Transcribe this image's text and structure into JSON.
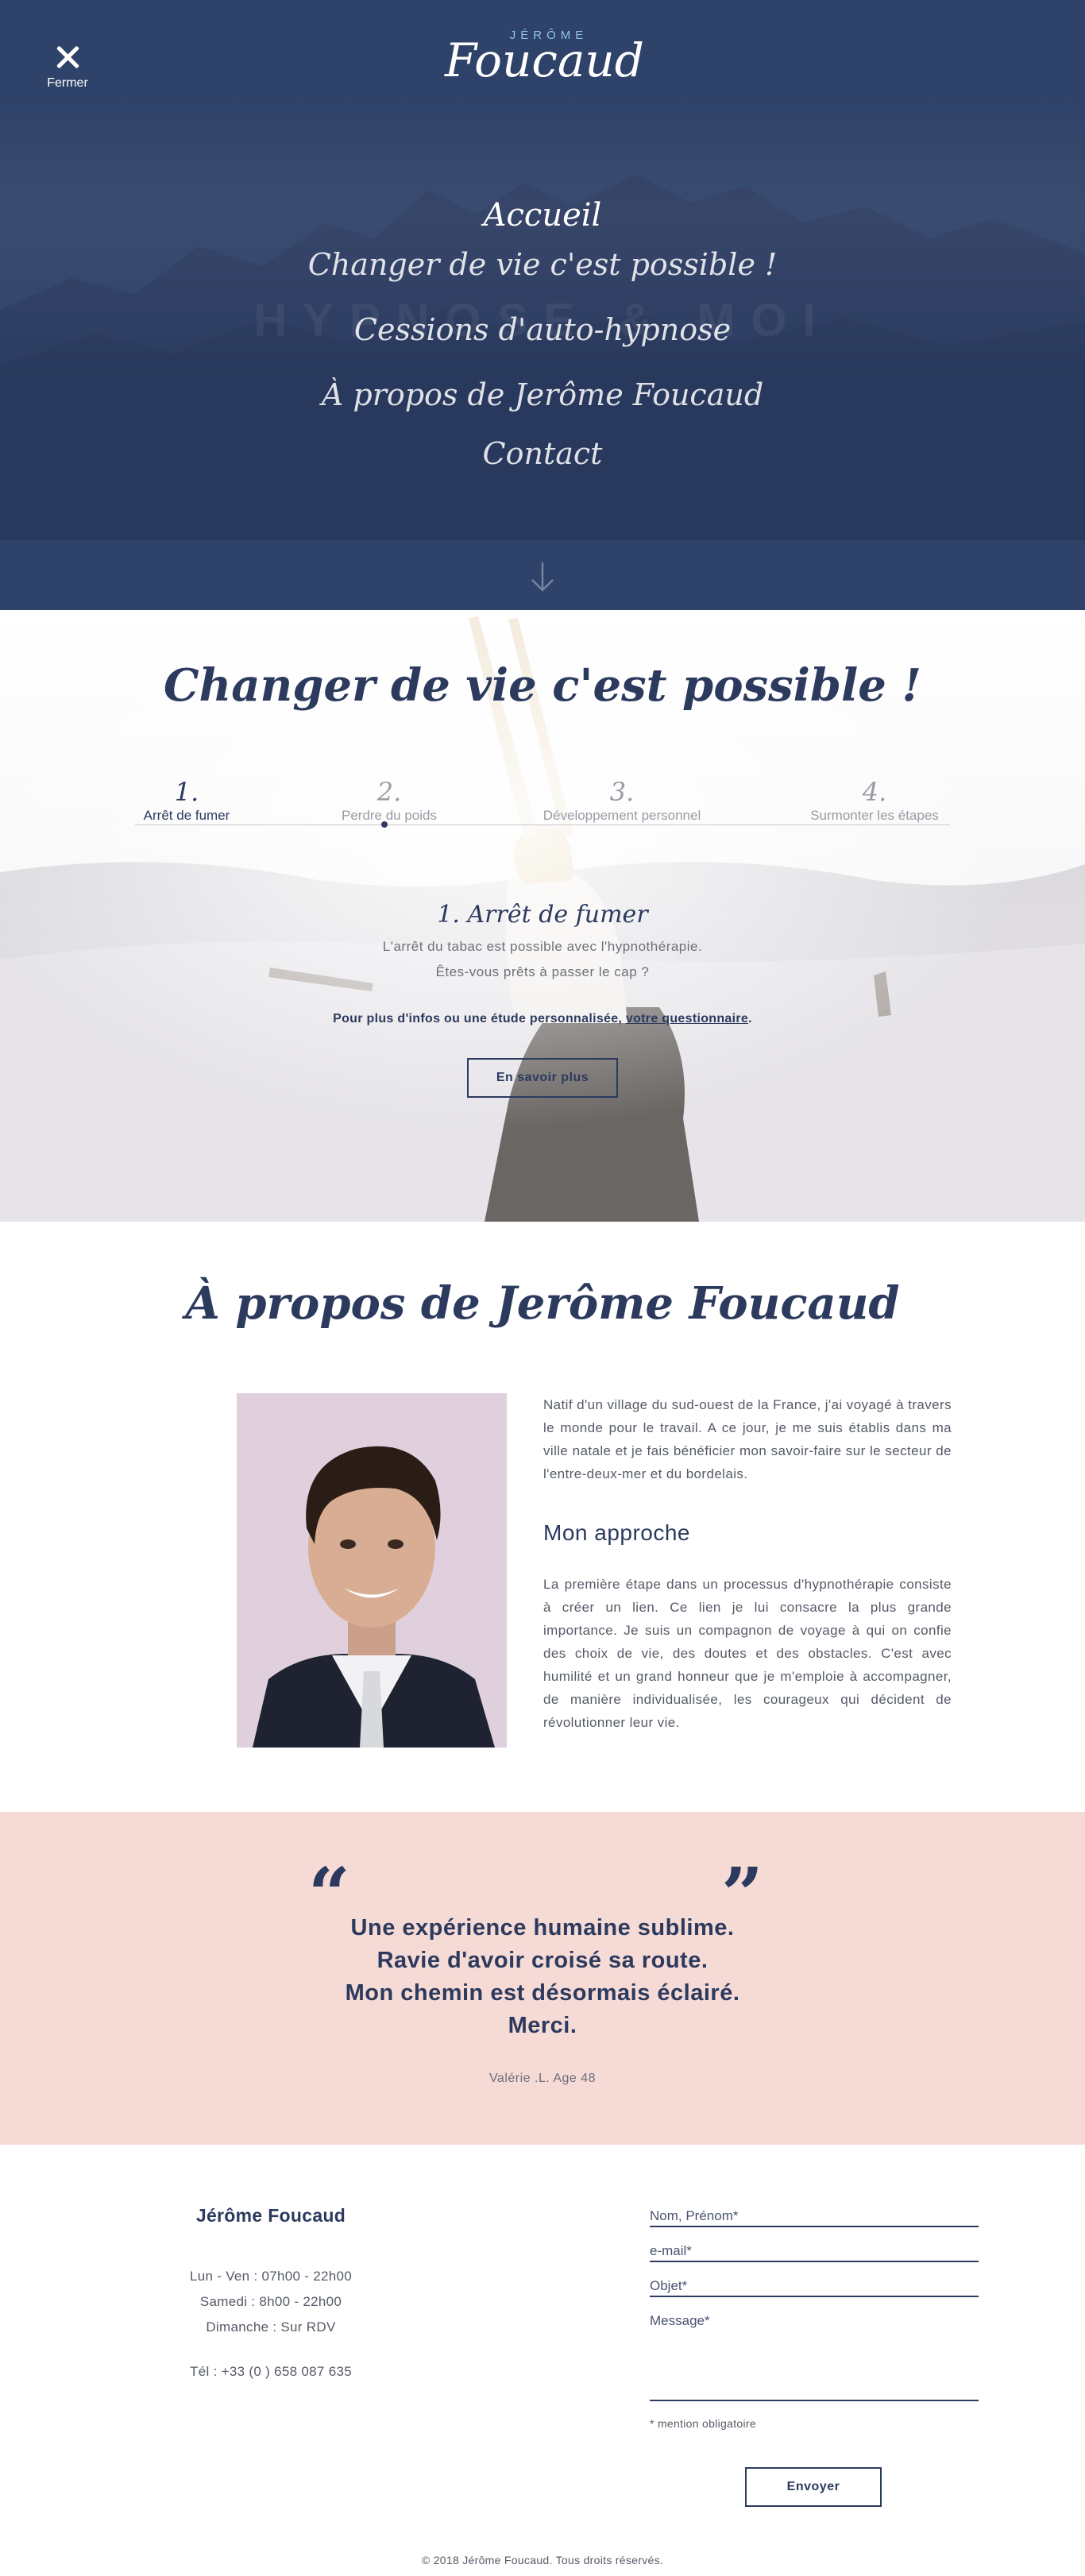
{
  "hero": {
    "close_label": "Fermer",
    "logo_first": "JÉRÔME",
    "logo_last": "Foucaud",
    "watermark": "HYPNOSE & MOI",
    "menu": [
      {
        "label": "Accueil",
        "active": true
      },
      {
        "label": "Changer de vie c'est possible !"
      },
      {
        "label": "Cessions d'auto-hypnose"
      },
      {
        "label": "À propos de Jerôme Foucaud"
      },
      {
        "label": "Contact"
      }
    ],
    "colors": {
      "background": "#2f4269",
      "logo_accent": "#8fc3e8"
    }
  },
  "changer": {
    "title": "Changer de vie c'est possible !",
    "steps": [
      {
        "number": "1.",
        "label": "Arrêt de fumer",
        "active": true
      },
      {
        "number": "2.",
        "label": "Perdre du poids",
        "active": false
      },
      {
        "number": "3.",
        "label": "Développement personnel",
        "active": false
      },
      {
        "number": "4.",
        "label": "Surmonter les étapes",
        "active": false
      }
    ],
    "active_title": "1. Arrêt de fumer",
    "lines": [
      "L'arrêt du tabac est possible avec l'hypnothérapie.",
      "Êtes-vous prêts à passer le cap ?"
    ],
    "cta_text": "Pour plus d'infos ou une étude personnalisée, ",
    "cta_link": "votre questionnaire",
    "cta_end": ".",
    "button": "En savoir plus"
  },
  "about": {
    "title": "À propos de Jerôme Foucaud",
    "intro": "Natif d'un village du sud-ouest de la France, j'ai voyagé à travers le monde pour le travail. A ce jour, je me suis établis dans ma ville natale et je fais bénéficier mon savoir-faire sur le secteur de l'entre-deux-mer et du bordelais.",
    "approach_title": "Mon approche",
    "approach_text": "La première étape dans un processus d'hypnothérapie consiste à créer un lien. Ce lien je lui consacre la plus grande importance. Je suis un compagnon de voyage à qui on confie des choix de vie, des doutes et des obstacles. C'est avec humilité et un grand honneur que je m'emploie à accompagner, de manière individualisée, les courageux qui décident de révolutionner leur vie."
  },
  "quote": {
    "lines": [
      "Une expérience humaine sublime.",
      "Ravie d'avoir croisé sa route.",
      "Mon chemin est désormais éclairé.",
      "Merci."
    ],
    "author": "Valérie .L. Age 48",
    "open_mark": "“",
    "close_mark": "”",
    "colors": {
      "background": "#f6dad5"
    }
  },
  "contact": {
    "name": "Jérôme Foucaud",
    "hours": [
      "Lun - Ven : 07h00 - 22h00",
      "Samedi : 8h00 - 22h00",
      "Dimanche : Sur RDV"
    ],
    "tel": "Tél : +33 (0 ) 658 087 635",
    "form": {
      "name_placeholder": "Nom, Prénom*",
      "email_placeholder": "e-mail*",
      "subject_placeholder": "Objet*",
      "message_placeholder": "Message*",
      "mention": "* mention obligatoire",
      "send": "Envoyer"
    },
    "copyright": "© 2018 Jérôme Foucaud. Tous droits réservés."
  }
}
